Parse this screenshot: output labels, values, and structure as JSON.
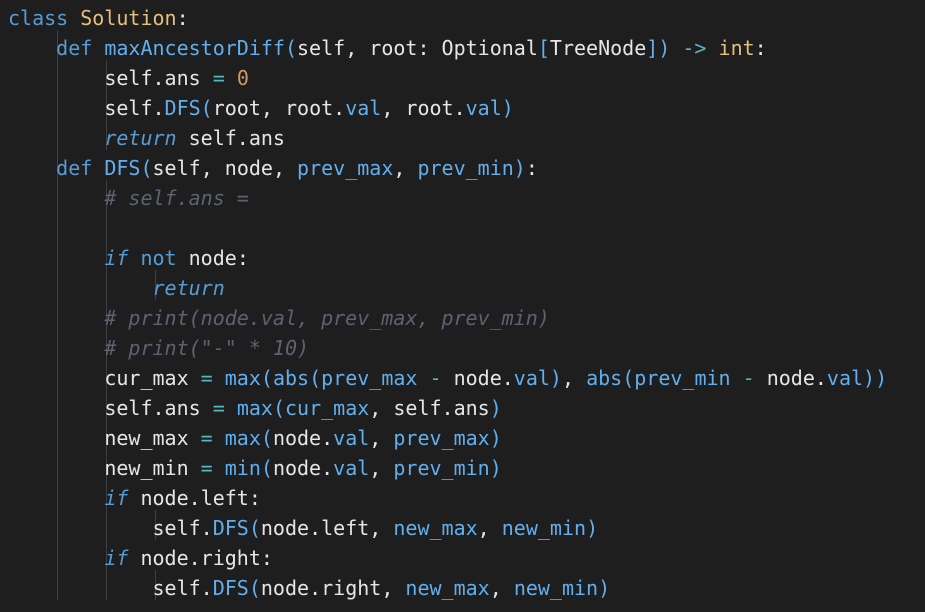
{
  "editor": {
    "lines": [
      "class Solution:",
      "    def maxAncestorDiff(self, root: Optional[TreeNode]) -> int:",
      "        self.ans = 0",
      "        self.DFS(root, root.val, root.val)",
      "        return self.ans",
      "    def DFS(self, node, prev_max, prev_min):",
      "        # self.ans =",
      "",
      "        if not node:",
      "            return",
      "        # print(node.val, prev_max, prev_min)",
      "        # print(\"-\" * 10)",
      "        cur_max = max(abs(prev_max - node.val), abs(prev_min - node.val))",
      "        self.ans = max(cur_max, self.ans)",
      "        new_max = max(node.val, prev_max)",
      "        new_min = min(node.val, prev_min)",
      "        if node.left:",
      "            self.DFS(node.left, new_max, new_min)",
      "        if node.right:",
      "            self.DFS(node.right, new_max, new_min)"
    ]
  },
  "colors": {
    "background": "#1e1e1e",
    "keyword": "#569cd6",
    "function": "#61afef",
    "class_name": "#e5c07b",
    "number": "#d19a66",
    "comment": "#5c6370",
    "text": "#e6e6e6"
  }
}
